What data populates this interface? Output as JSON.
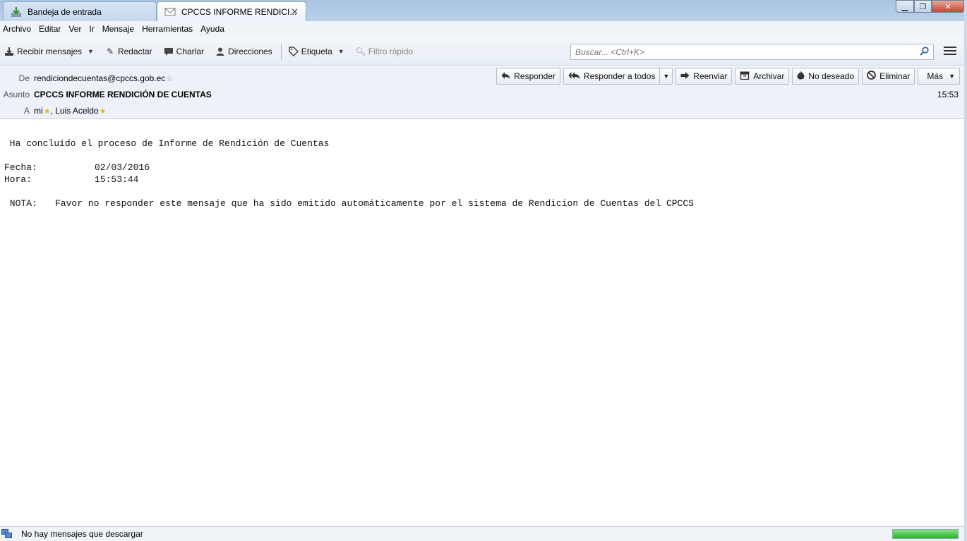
{
  "tabs": [
    {
      "label": "Bandeja de entrada"
    },
    {
      "label": "CPCCS INFORME RENDICI..."
    }
  ],
  "menu": [
    "Archivo",
    "Editar",
    "Ver",
    "Ir",
    "Mensaje",
    "Herramientas",
    "Ayuda"
  ],
  "toolbar": {
    "get_mail": "Recibir mensajes",
    "compose": "Redactar",
    "chat": "Charlar",
    "address_book": "Direcciones",
    "tag": "Etiqueta",
    "quick_filter": "Filtro rápido",
    "search_placeholder": "Buscar... <Ctrl+K>"
  },
  "header": {
    "from_label": "De",
    "from_value": "rendiciondecuentas@cpccs.gob.ec",
    "subject_label": "Asunto",
    "subject_value": "CPCCS INFORME RENDICIÓN DE CUENTAS",
    "to_label": "A",
    "to_value_1": "mi",
    "to_value_2": ", Luis Aceldo",
    "time": "15:53",
    "actions": {
      "reply": "Responder",
      "reply_all": "Responder a todos",
      "forward": "Reenviar",
      "archive": "Archivar",
      "junk": "No deseado",
      "delete": "Eliminar",
      "more": "Más"
    }
  },
  "body": {
    "line1": " Ha concluido el proceso de Informe de Rendición de Cuentas",
    "fecha_label": "Fecha:",
    "fecha_value": "02/03/2016",
    "hora_label": "Hora:",
    "hora_value": "15:53:44",
    "nota_label": " NOTA:",
    "nota_value": "Favor no responder este mensaje que ha sido emitido automáticamente por el sistema de Rendicion de Cuentas del CPCCS"
  },
  "status": {
    "text": "No hay mensajes que descargar",
    "progress": 1.0
  },
  "colors": {
    "titlebar": "#b9d1ea",
    "header_bg": "#edf1f8",
    "close_button": "#c7462c",
    "progress": "#2db12d"
  }
}
